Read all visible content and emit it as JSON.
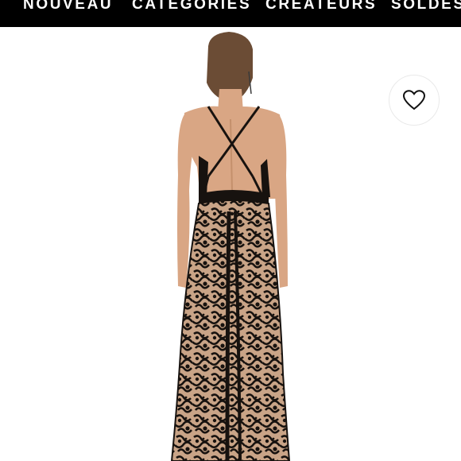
{
  "nav": {
    "items": [
      {
        "label": "NOUVEAU"
      },
      {
        "label": "CATEGORIES"
      },
      {
        "label": "CREATEURS"
      },
      {
        "label": "SOLDES"
      }
    ]
  },
  "product": {
    "image": "black-lace-backless-maxi-dress",
    "favorite_icon": "heart-outline-icon"
  },
  "colors": {
    "nav_bg": "#000000",
    "nav_text": "#ffffff",
    "dress_lace": "#17120f",
    "dress_lining": "#c9a487",
    "skin": "#d9a684"
  }
}
